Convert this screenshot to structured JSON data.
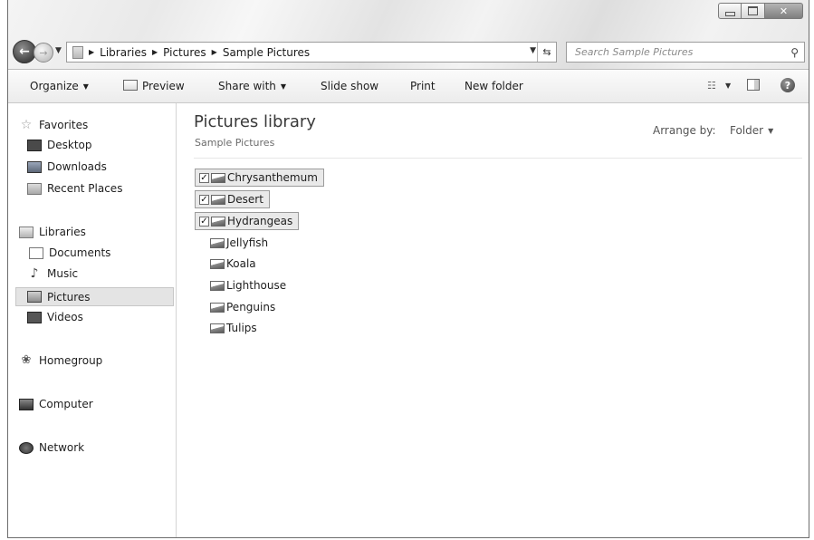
{
  "address_bar": {
    "crumbs": [
      "Libraries",
      "Pictures",
      "Sample Pictures"
    ]
  },
  "search": {
    "placeholder": "Search Sample Pictures"
  },
  "toolbar": {
    "organize_label": "Organize",
    "preview_label": "Preview",
    "share_with_label": "Share with",
    "slide_show_label": "Slide show",
    "print_label": "Print",
    "new_folder_label": "New folder"
  },
  "sidebar": {
    "favorites": {
      "label": "Favorites",
      "items": [
        {
          "label": "Desktop",
          "icon": "desktop-icon"
        },
        {
          "label": "Downloads",
          "icon": "downloads-icon"
        },
        {
          "label": "Recent Places",
          "icon": "recent-places-icon"
        }
      ]
    },
    "libraries": {
      "label": "Libraries",
      "items": [
        {
          "label": "Documents",
          "icon": "documents-icon"
        },
        {
          "label": "Music",
          "icon": "music-icon"
        },
        {
          "label": "Pictures",
          "icon": "pictures-icon",
          "selected": true
        },
        {
          "label": "Videos",
          "icon": "videos-icon"
        }
      ]
    },
    "homegroup_label": "Homegroup",
    "computer_label": "Computer",
    "network_label": "Network"
  },
  "content": {
    "title": "Pictures library",
    "subtitle": "Sample Pictures",
    "arrange_by_label": "Arrange by:",
    "arrange_by_value": "Folder",
    "files": [
      {
        "name": "Chrysanthemum",
        "selected": true
      },
      {
        "name": "Desert",
        "selected": true
      },
      {
        "name": "Hydrangeas",
        "selected": true
      },
      {
        "name": "Jellyfish",
        "selected": false
      },
      {
        "name": "Koala",
        "selected": false
      },
      {
        "name": "Lighthouse",
        "selected": false
      },
      {
        "name": "Penguins",
        "selected": false
      },
      {
        "name": "Tulips",
        "selected": false
      }
    ]
  },
  "colors": {
    "selection_bg": "#e9e9e9",
    "selection_border": "#9b9b9b",
    "nav_selected_bg": "#e4e4e4"
  }
}
